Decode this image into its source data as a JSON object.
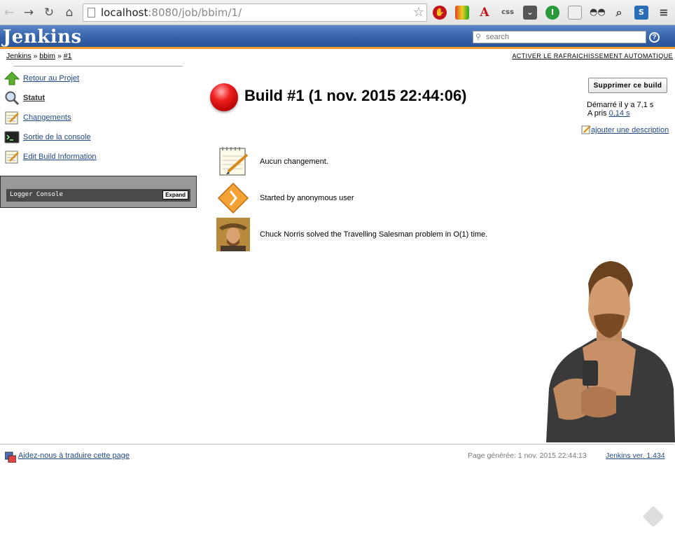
{
  "browser": {
    "url_host": "localhost",
    "url_path": ":8080/job/bbim/1/"
  },
  "header": {
    "logo": "Jenkins",
    "search_placeholder": "search",
    "help": "?"
  },
  "breadcrumb": [
    "Jenkins",
    "bbim",
    "#1"
  ],
  "auto_refresh": "ACTIVER LE RAFRAICHISSEMENT AUTOMATIQUE",
  "sidebar": {
    "tasks": [
      {
        "label": "Retour au Projet",
        "icon": "up-arrow-icon"
      },
      {
        "label": "Statut",
        "icon": "magnifier-icon"
      },
      {
        "label": "Changements",
        "icon": "notepad-icon"
      },
      {
        "label": "Sortie de la console",
        "icon": "terminal-icon"
      },
      {
        "label": "Edit Build Information",
        "icon": "notepad-icon"
      }
    ],
    "logger": {
      "title": "Logger Console",
      "expand": "Expand"
    }
  },
  "build": {
    "title": "Build #1 (1 nov. 2015 22:44:06)",
    "delete_button": "Supprimer ce build",
    "started": "Démarré il y a 7,1 s",
    "took_label": "A pris",
    "took_value": "0,14 s",
    "add_description": "ajouter une description",
    "status_color": "#e02020"
  },
  "summary": [
    {
      "icon": "notepad-icon",
      "text": "Aucun changement."
    },
    {
      "icon": "cause-diamond-icon",
      "text": "Started by anonymous user"
    },
    {
      "icon": "chuck-portrait-icon",
      "text": "Chuck Norris solved the Travelling Salesman problem in O(1) time."
    }
  ],
  "footer": {
    "translate": "Aidez-nous à traduire cette page",
    "generated": "Page générée: 1 nov. 2015 22:44:13",
    "version": "Jenkins ver. 1.434"
  }
}
